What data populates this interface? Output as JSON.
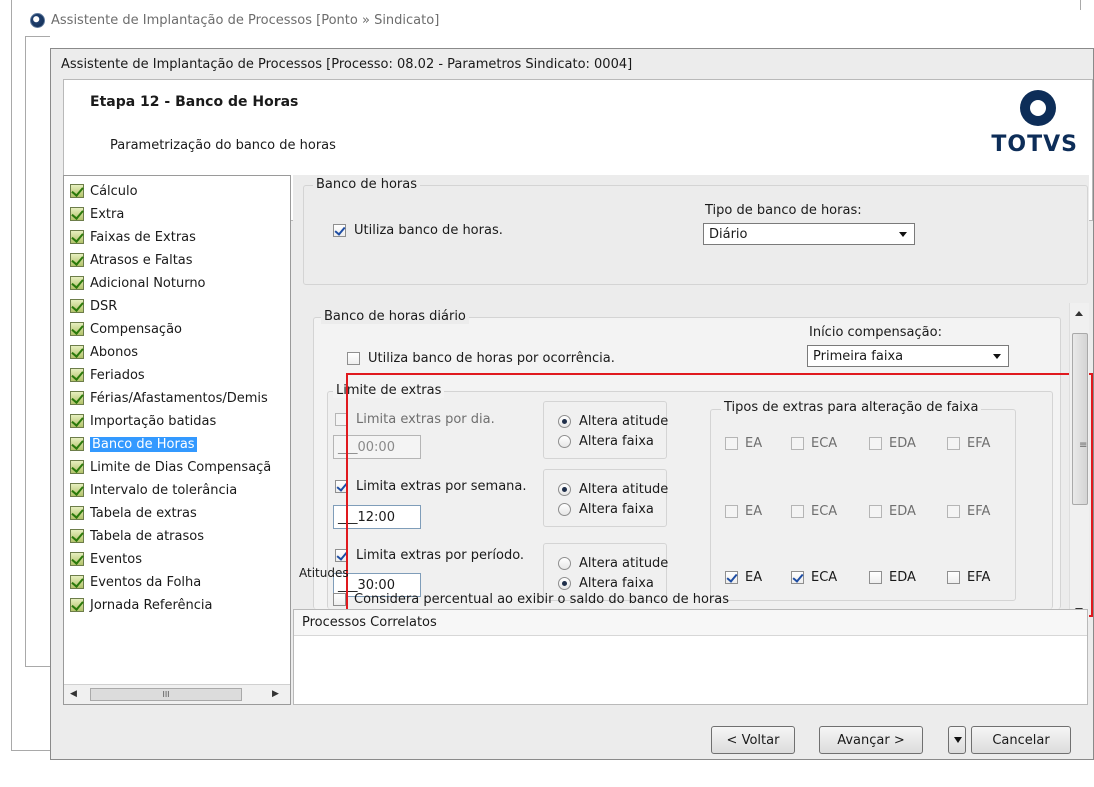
{
  "outer_window": {
    "title": "Assistente de Implantação de Processos [Ponto » Sindicato]"
  },
  "window": {
    "title": "Assistente de Implantação de Processos [Processo: 08.02 - Parametros Sindicato: 0004]"
  },
  "header": {
    "step_title": "Etapa 12 - Banco de Horas",
    "step_subtitle": "Parametrização do banco de horas",
    "logo_text": "TOTVS"
  },
  "tree": {
    "items": [
      {
        "label": "Cálculo"
      },
      {
        "label": "Extra"
      },
      {
        "label": "Faixas de Extras"
      },
      {
        "label": "Atrasos e Faltas"
      },
      {
        "label": "Adicional Noturno"
      },
      {
        "label": "DSR"
      },
      {
        "label": "Compensação"
      },
      {
        "label": "Abonos"
      },
      {
        "label": "Feriados"
      },
      {
        "label": "Férias/Afastamentos/Demis"
      },
      {
        "label": "Importação batidas"
      },
      {
        "label": "Banco de Horas",
        "selected": true
      },
      {
        "label": "Limite de Dias Compensaçã"
      },
      {
        "label": "Intervalo de tolerância"
      },
      {
        "label": "Tabela de extras"
      },
      {
        "label": "Tabela de atrasos"
      },
      {
        "label": "Eventos"
      },
      {
        "label": "Eventos da Folha"
      },
      {
        "label": "Jornada Referência"
      }
    ],
    "scroll_thumb_glyph": "III"
  },
  "banco": {
    "group_label": "Banco de horas",
    "utiliza_label": "Utiliza banco de horas.",
    "utiliza_checked": true,
    "tipo_label": "Tipo de banco de horas:",
    "tipo_value": "Diário"
  },
  "diario": {
    "group_label": "Banco de horas diário",
    "ocorrencia_label": "Utiliza banco de horas por ocorrência.",
    "ocorrencia_checked": false,
    "inicio_label": "Início compensação:",
    "inicio_value": "Primeira faixa"
  },
  "limite": {
    "group_label": "Limite de extras",
    "rows": [
      {
        "label": "Limita extras por dia.",
        "checked": false,
        "value": "___00:00",
        "enabled": false,
        "radio_selected": "Altera atitude"
      },
      {
        "label": "Limita extras por semana.",
        "checked": true,
        "value": "___12:00",
        "enabled": true,
        "radio_selected": "Altera atitude"
      },
      {
        "label": "Limita extras por período.",
        "checked": true,
        "value": "___30:00",
        "enabled": true,
        "radio_selected": "Altera faixa"
      }
    ],
    "radio_labels": {
      "atitude": "Altera atitude",
      "faixa": "Altera faixa"
    }
  },
  "tipos": {
    "group_label": "Tipos de extras para alteração de faixa",
    "columns": [
      "EA",
      "ECA",
      "EDA",
      "EFA"
    ],
    "rows": [
      {
        "enabled": false,
        "checked": [
          false,
          false,
          false,
          false
        ]
      },
      {
        "enabled": false,
        "checked": [
          false,
          false,
          false,
          false
        ]
      },
      {
        "enabled": true,
        "checked": [
          true,
          true,
          false,
          false
        ]
      }
    ]
  },
  "atitudes": {
    "group_label": "Atitudes"
  },
  "considera": {
    "label": "Considera percentual ao exibir o saldo do banco de horas",
    "checked": false
  },
  "correlatos": {
    "header": "Processos Correlatos"
  },
  "buttons": {
    "back": "< Voltar",
    "next": "Avançar >",
    "cancel": "Cancelar"
  },
  "colors": {
    "highlight_border": "#e0191e",
    "selection": "#3399ff",
    "brand": "#0d2d58"
  },
  "icons": {
    "app": "totvs-app-icon",
    "tree_check": "green-check-icon",
    "toolbar": "toolbar-icon"
  }
}
